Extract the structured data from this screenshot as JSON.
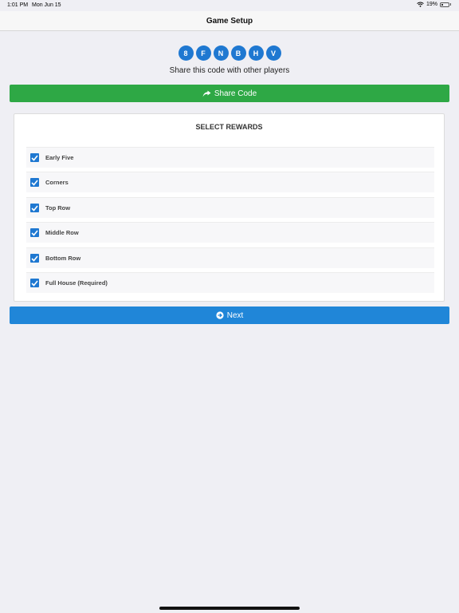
{
  "status_bar": {
    "time": "1:01 PM",
    "date": "Mon Jun 15",
    "battery": "19%",
    "battery_level": 0.19,
    "icons": [
      "wifi-icon",
      "battery-icon"
    ]
  },
  "nav": {
    "title": "Game Setup"
  },
  "code": {
    "chars": [
      "8",
      "F",
      "N",
      "B",
      "H",
      "V"
    ],
    "share_text": "Share this code with other players",
    "color": "#1f78d1"
  },
  "share_button": {
    "label": "Share Code",
    "icon": "share-icon",
    "color": "#2ea845"
  },
  "rewards": {
    "title": "SELECT REWARDS",
    "items": [
      {
        "label": "Early Five",
        "checked": true
      },
      {
        "label": "Corners",
        "checked": true
      },
      {
        "label": "Top Row",
        "checked": true
      },
      {
        "label": "Middle Row",
        "checked": true
      },
      {
        "label": "Bottom Row",
        "checked": true
      },
      {
        "label": "Full House (Required)",
        "checked": true
      }
    ]
  },
  "next_button": {
    "label": "Next",
    "icon": "arrow-circle-right-icon",
    "color": "#2086d8"
  }
}
